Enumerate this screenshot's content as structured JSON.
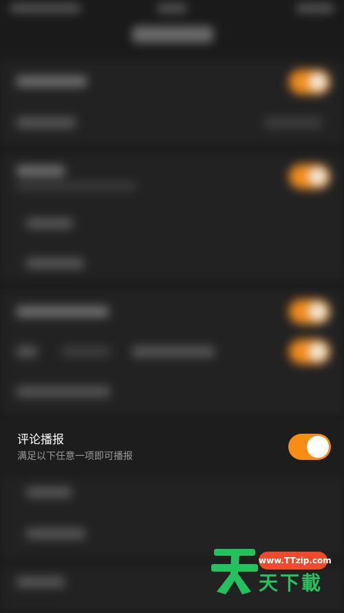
{
  "comment_broadcast": {
    "title": "评论播报",
    "subtitle": "满足以下任意一项即可播报",
    "toggle_on": true,
    "accent_color": "#f78d12"
  },
  "watermark": {
    "url": "www.TTzip.com",
    "brand": "天下載",
    "logo_char": "天",
    "brand_color": "#23c25f",
    "pill_color": "#ef4a2b"
  }
}
